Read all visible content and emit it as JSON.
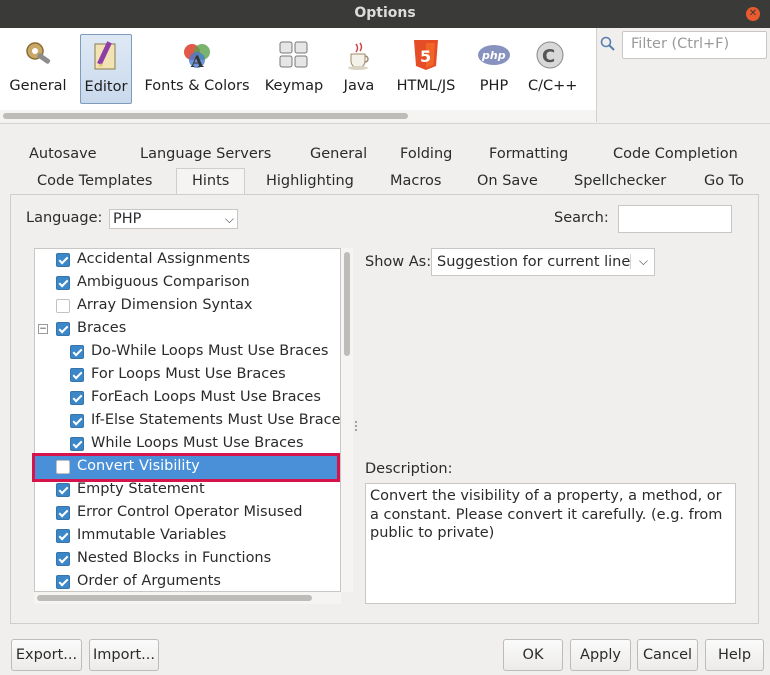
{
  "window": {
    "title": "Options"
  },
  "toolbar": {
    "items": [
      {
        "label": "General",
        "icon": "gear-wrench-icon"
      },
      {
        "label": "Editor",
        "icon": "editor-pencil-icon"
      },
      {
        "label": "Fonts & Colors",
        "icon": "fonts-colors-icon"
      },
      {
        "label": "Keymap",
        "icon": "keyboard-icon"
      },
      {
        "label": "Java",
        "icon": "java-cup-icon"
      },
      {
        "label": "HTML/JS",
        "icon": "html5-icon"
      },
      {
        "label": "PHP",
        "icon": "php-icon"
      },
      {
        "label": "C/C++",
        "icon": "cpp-icon"
      }
    ],
    "selected": "Editor"
  },
  "filter": {
    "placeholder": "Filter (Ctrl+F)"
  },
  "tabs": {
    "row1": [
      "Autosave",
      "Language Servers",
      "General",
      "Folding",
      "Formatting",
      "Code Completion"
    ],
    "row2": [
      "Code Templates",
      "Hints",
      "Highlighting",
      "Macros",
      "On Save",
      "Spellchecker",
      "Go To"
    ],
    "active": "Hints"
  },
  "language": {
    "label": "Language:",
    "value": "PHP"
  },
  "search": {
    "label": "Search:",
    "value": ""
  },
  "hints": [
    {
      "label": "Accidental Assignments",
      "checked": true,
      "indent": 0
    },
    {
      "label": "Ambiguous Comparison",
      "checked": true,
      "indent": 0
    },
    {
      "label": "Array Dimension Syntax",
      "checked": false,
      "indent": 0
    },
    {
      "label": "Braces",
      "checked": true,
      "indent": 0,
      "expanded": true
    },
    {
      "label": "Do-While Loops Must Use Braces",
      "checked": true,
      "indent": 1
    },
    {
      "label": "For Loops Must Use Braces",
      "checked": true,
      "indent": 1
    },
    {
      "label": "ForEach Loops Must Use Braces",
      "checked": true,
      "indent": 1
    },
    {
      "label": "If-Else Statements Must Use Braces",
      "checked": true,
      "indent": 1
    },
    {
      "label": "While Loops Must Use Braces",
      "checked": true,
      "indent": 1
    },
    {
      "label": "Convert Visibility",
      "checked": false,
      "indent": 0,
      "selected": true
    },
    {
      "label": "Empty Statement",
      "checked": true,
      "indent": 0
    },
    {
      "label": "Error Control Operator Misused",
      "checked": true,
      "indent": 0
    },
    {
      "label": "Immutable Variables",
      "checked": true,
      "indent": 0
    },
    {
      "label": "Nested Blocks in Functions",
      "checked": true,
      "indent": 0
    },
    {
      "label": "Order of Arguments",
      "checked": true,
      "indent": 0
    }
  ],
  "show_as": {
    "label": "Show As:",
    "value": "Suggestion for current line"
  },
  "description": {
    "label": "Description:",
    "text": "Convert the visibility of a property, a method, or a constant. Please convert it carefully. (e.g. from public to private)"
  },
  "buttons": {
    "export": "Export...",
    "import": "Import...",
    "ok": "OK",
    "apply": "Apply",
    "cancel": "Cancel",
    "help": "Help"
  },
  "colors": {
    "selection": "#4a90d9",
    "highlight_border": "#d6134a",
    "checkbox": "#3b87c8"
  }
}
